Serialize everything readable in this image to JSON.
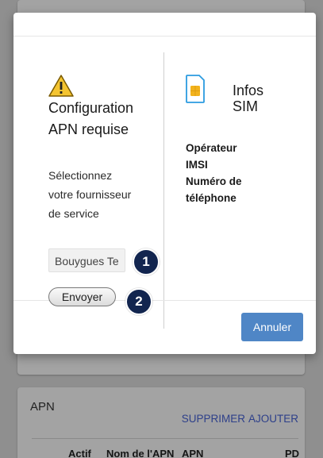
{
  "modal": {
    "config_title_line1": "Configuration",
    "config_title_line2": "APN requise",
    "select_text_line1": "Sélectionnez",
    "select_text_line2": "votre fournisseur",
    "select_text_line3": "de service",
    "provider_value": "Bouygues Te",
    "send_label": "Envoyer",
    "sim_title_line1": "Infos",
    "sim_title_line2": "SIM",
    "sim_fields": [
      "Opérateur",
      "IMSI",
      "Numéro de",
      "téléphone"
    ],
    "cancel_label": "Annuler"
  },
  "badges": [
    "1",
    "2"
  ],
  "background": {
    "apn_title": "APN",
    "delete_label": "SUPPRIMER",
    "add_label": "AJOUTER",
    "columns": [
      "Actif",
      "Nom de l'APN",
      "APN",
      "PD"
    ]
  },
  "icons": {
    "warning": "warning-icon",
    "sim": "sim-card-icon"
  },
  "colors": {
    "accent_button": "#4f86c6",
    "badge": "#12254f",
    "link": "#2d3f8a",
    "warning_fill": "#f4c430",
    "sim_chip": "#f2b21c",
    "sim_frame": "#2b9be0"
  }
}
